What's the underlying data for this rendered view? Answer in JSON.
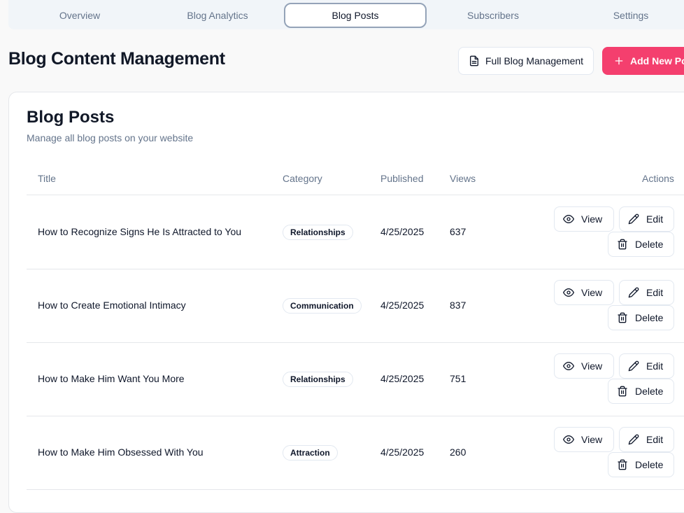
{
  "tabs": [
    {
      "label": "Overview"
    },
    {
      "label": "Blog Analytics"
    },
    {
      "label": "Blog Posts"
    },
    {
      "label": "Subscribers"
    },
    {
      "label": "Settings"
    }
  ],
  "active_tab": "Blog Posts",
  "header": {
    "title": "Blog Content Management",
    "full_mgmt_label": "Full Blog Management",
    "add_new_label": "Add New Post"
  },
  "card": {
    "title": "Blog Posts",
    "subtitle": "Manage all blog posts on your website"
  },
  "table": {
    "columns": [
      "Title",
      "Category",
      "Published",
      "Views",
      "Actions"
    ],
    "rows": [
      {
        "title": "How to Recognize Signs He Is Attracted to You",
        "category": "Relationships",
        "published": "4/25/2025",
        "views": "637"
      },
      {
        "title": "How to Create Emotional Intimacy",
        "category": "Communication",
        "published": "4/25/2025",
        "views": "837"
      },
      {
        "title": "How to Make Him Want You More",
        "category": "Relationships",
        "published": "4/25/2025",
        "views": "751"
      },
      {
        "title": "How to Make Him Obsessed With You",
        "category": "Attraction",
        "published": "4/25/2025",
        "views": "260"
      }
    ],
    "actions": {
      "view": "View",
      "edit": "Edit",
      "delete": "Delete"
    }
  },
  "colors": {
    "accent": "#f43f6e",
    "muted_text": "#64748b",
    "border": "#e2e8f0"
  }
}
